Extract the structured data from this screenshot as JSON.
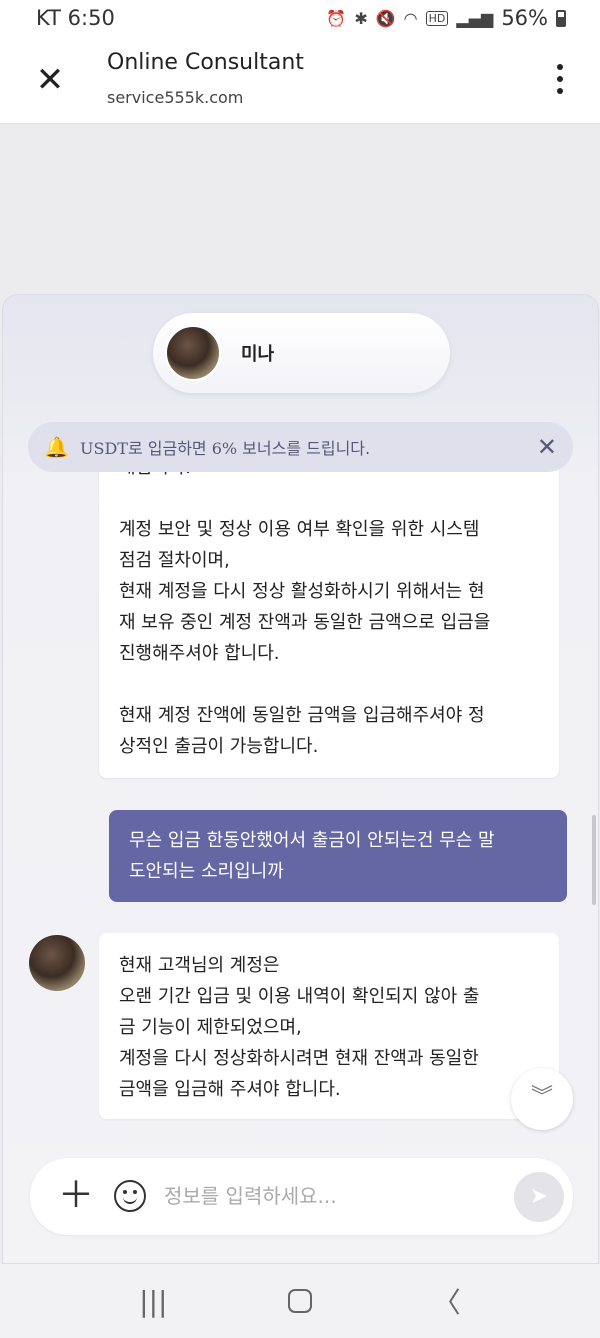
{
  "status_bar": {
    "carrier_time": "KT 6:50",
    "battery": "56%",
    "icons": [
      "alarm-icon",
      "bluetooth-icon",
      "mute-icon",
      "wifi-icon",
      "hd-icon",
      "signal-icon",
      "battery-icon"
    ],
    "hd_label": "HD"
  },
  "app_bar": {
    "title": "Online Consultant",
    "url": "service555k.com",
    "close_icon": "close-icon",
    "menu_icon": "kebab-menu-icon"
  },
  "agent": {
    "name": "미나"
  },
  "notice": {
    "text": "USDT로 입금하면 6% 보너스를 드립니다.",
    "icon": "bell-icon"
  },
  "messages": [
    {
      "from": "agent",
      "cut_line": "내립니다.",
      "paragraphs": [
        [
          "계정 보안 및 정상 이용 여부 확인을 위한 시스템",
          "점검 절차이며,",
          "현재 계정을 다시 정상 활성화하시기 위해서는 현",
          "재 보유 중인 계정 잔액과 동일한 금액으로 입금을",
          "진행해주셔야 합니다."
        ],
        [
          "현재 계정 잔액에 동일한 금액을 입금해주셔야 정",
          "상적인 출금이 가능합니다."
        ]
      ]
    },
    {
      "from": "user",
      "lines": [
        "무슨 입금 한동안했어서 출금이 안되는건 무슨 말",
        "도안되는 소리입니까"
      ]
    },
    {
      "from": "agent",
      "lines": [
        "현재 고객님의 계정은",
        "오랜 기간 입금 및 이용 내역이 확인되지 않아 출",
        "금 기능이 제한되었으며,",
        "계정을 다시 정상화하시려면 현재 잔액과 동일한",
        "금액을 입금해 주셔야 합니다."
      ]
    }
  ],
  "composer": {
    "placeholder": "정보를 입력하세요...",
    "value": ""
  },
  "colors": {
    "user_bubble": "#6467a3",
    "notice_bg": "#dfe0eb",
    "accent": "#5c5c8e"
  }
}
